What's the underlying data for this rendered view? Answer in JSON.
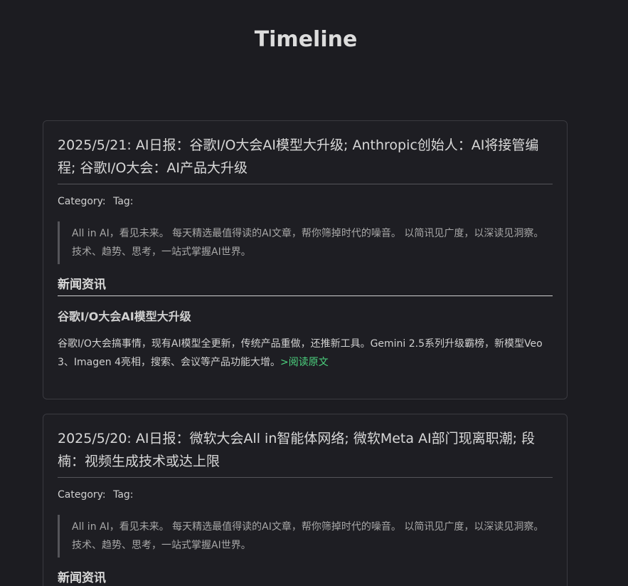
{
  "page": {
    "title": "Timeline"
  },
  "posts": [
    {
      "title": "2025/5/21: AI日报：谷歌I/O大会AI模型大升级; Anthropic创始人：AI将接管编程; 谷歌I/O大会：AI产品大升级",
      "category_label": "Category:",
      "tag_label": "Tag:",
      "quote": "All in AI，看见未来。 每天精选最值得读的AI文章，帮你筛掉时代的噪音。 以简讯见广度，以深读见洞察。 技术、趋势、思考，一站式掌握AI世界。",
      "section_heading": "新闻资讯",
      "item_title": "谷歌I/O大会AI模型大升级",
      "item_body": "谷歌I/O大会搞事情，现有AI模型全更新，传统产品重做，还推新工具。Gemini 2.5系列升级霸榜，新模型Veo 3、Imagen 4亮相，搜索、会议等产品功能大增。",
      "read_more": ">阅读原文"
    },
    {
      "title": "2025/5/20: AI日报：微软大会All in智能体网络; 微软Meta AI部门现离职潮; 段楠：视频生成技术或达上限",
      "category_label": "Category:",
      "tag_label": "Tag:",
      "quote": "All in AI，看见未来。 每天精选最值得读的AI文章，帮你筛掉时代的噪音。 以简讯见广度，以深读见洞察。 技术、趋势、思考，一站式掌握AI世界。",
      "section_heading": "新闻资讯"
    }
  ],
  "colors": {
    "background": "#1c1c21",
    "card_border": "#3a3a40",
    "link": "#4cd37f"
  }
}
